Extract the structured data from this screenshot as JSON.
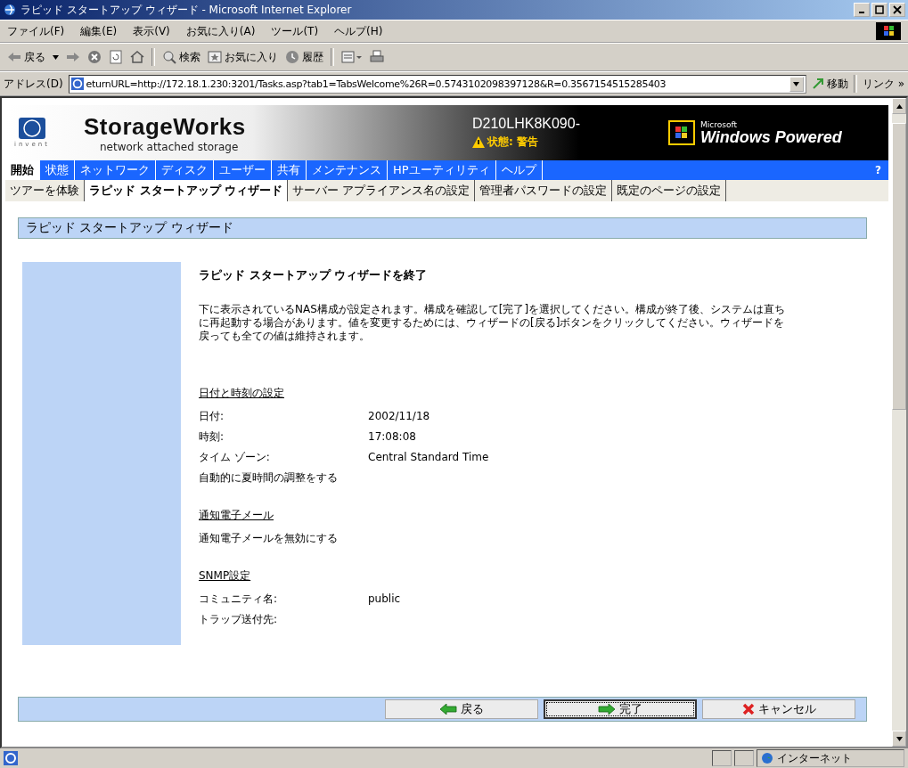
{
  "window": {
    "title": "ラピッド スタートアップ ウィザード - Microsoft Internet Explorer"
  },
  "menu": [
    "ファイル(F)",
    "編集(E)",
    "表示(V)",
    "お気に入り(A)",
    "ツール(T)",
    "ヘルプ(H)"
  ],
  "toolbar": {
    "back": "戻る",
    "search": "検索",
    "favorites": "お気に入り",
    "history": "履歴"
  },
  "address": {
    "label": "アドレス(D)",
    "value": "eturnURL=http://172.18.1.230:3201/Tasks.asp?tab1=TabsWelcome%26R=0.5743102098397128&R=0.3567154515285403",
    "go": "移動",
    "links": "リンク »"
  },
  "header": {
    "logo_tag": "invent",
    "brand": "StorageWorks",
    "tagline": "network attached storage",
    "server": "D210LHK8K090-",
    "status": "状態: 警告",
    "badge_small": "Microsoft",
    "badge": "Windows Powered"
  },
  "nav": [
    {
      "label": "開始",
      "selected": true
    },
    {
      "label": "状態",
      "selected": false
    },
    {
      "label": "ネットワーク",
      "selected": false
    },
    {
      "label": "ディスク",
      "selected": false
    },
    {
      "label": "ユーザー",
      "selected": false
    },
    {
      "label": "共有",
      "selected": false
    },
    {
      "label": "メンテナンス",
      "selected": false
    },
    {
      "label": "HPユーティリティ",
      "selected": false
    },
    {
      "label": "ヘルプ",
      "selected": false
    }
  ],
  "nav_help": "?",
  "subnav": [
    {
      "label": "ツアーを体験",
      "selected": false
    },
    {
      "label": "ラピッド スタートアップ ウィザード",
      "selected": true
    },
    {
      "label": "サーバー アプライアンス名の設定",
      "selected": false
    },
    {
      "label": "管理者パスワードの設定",
      "selected": false
    },
    {
      "label": "既定のページの設定",
      "selected": false
    }
  ],
  "page_title": "ラピッド スタートアップ ウィザード",
  "heading": "ラピッド スタートアップ ウィザードを終了",
  "intro": "下に表示されているNAS構成が設定されます。構成を確認して[完了]を選択してください。構成が終了後、システムは直ちに再起動する場合があります。値を変更するためには、ウィザードの[戻る]ボタンをクリックしてください。ウィザードを戻っても全ての値は維持されます。",
  "sections": [
    {
      "title": "日付と時刻の設定",
      "rows": [
        {
          "label": "日付:",
          "value": "2002/11/18"
        },
        {
          "label": "時刻:",
          "value": "17:08:08"
        },
        {
          "label": "タイム ゾーン:",
          "value": "Central Standard Time"
        },
        {
          "label": "自動的に夏時間の調整をする"
        }
      ]
    },
    {
      "title": "通知電子メール",
      "rows": [
        {
          "label": "通知電子メールを無効にする"
        }
      ]
    },
    {
      "title": "SNMP設定",
      "rows": [
        {
          "label": "コミュニティ名:",
          "value": "public"
        },
        {
          "label": "トラップ送付先:"
        }
      ]
    }
  ],
  "buttons": [
    {
      "kind": "back",
      "label": "戻る",
      "focused": false
    },
    {
      "kind": "finish",
      "label": "完了",
      "focused": true
    },
    {
      "kind": "cancel",
      "label": "キャンセル",
      "focused": false
    }
  ],
  "status_bar": {
    "zone": "インターネット"
  }
}
